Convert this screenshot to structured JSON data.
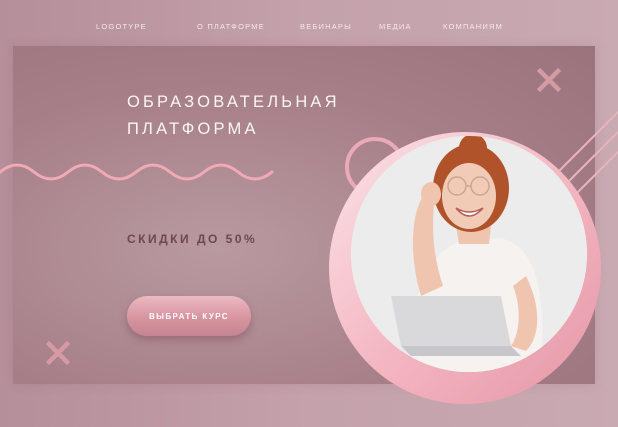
{
  "nav": {
    "logo": "LOGOTYPE",
    "items": [
      "О ПЛАТФОРМЕ",
      "ВЕБИНАРЫ",
      "МЕДИА",
      "КОМПАНИЯМ"
    ]
  },
  "hero": {
    "title_line1": "ОБРАЗОВАТЕЛЬНАЯ",
    "title_line2": "ПЛАТФОРМА",
    "discount": "СКИДКИ ДО 50%",
    "cta_label": "ВЫБРАТЬ КУРС"
  },
  "icons": [
    "cross-icon",
    "cross-icon",
    "wave-decoration",
    "ring-decoration",
    "diagonal-lines-decoration"
  ],
  "colors": {
    "background": "#c4a1ab",
    "panel": "#a77f89",
    "accent_pink": "#f0a9b5",
    "discount_text": "#6f4651",
    "button": "#d7949f"
  }
}
